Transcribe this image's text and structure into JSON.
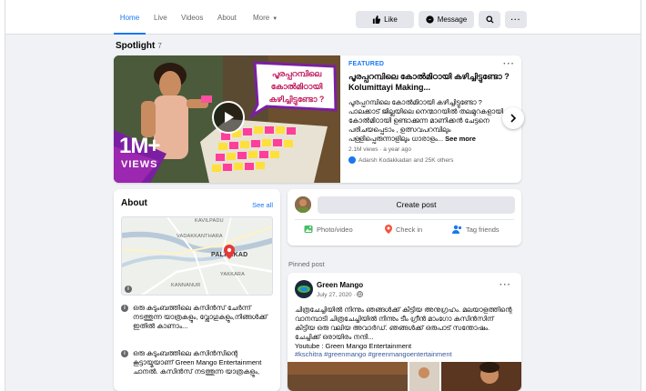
{
  "nav": {
    "tabs": [
      {
        "label": "Home",
        "active": true
      },
      {
        "label": "Live"
      },
      {
        "label": "Videos"
      },
      {
        "label": "About"
      },
      {
        "label": "More"
      }
    ],
    "like_label": "Like",
    "message_label": "Message"
  },
  "spotlight": {
    "title": "Spotlight",
    "count": "7",
    "thumbnail": {
      "overlay_text": "പൂരപ്പറമ്പിലെ കോൽമിഠായി കഴിച്ചിട്ടുണ്ടോ ?",
      "views_big": "1M+",
      "views_label": "VIEWS"
    },
    "featured_label": "FEATURED",
    "headline": "പൂരപ്പറമ്പിലെ കോൽമിഠായി കഴിച്ചിട്ടുണ്ടോ ? Kolumittayi Making...",
    "description": "പൂരപ്പറമ്പിലെ കോൽമിഠായി കഴിച്ചിട്ടുണ്ടോ ? പാലക്കാട് ജില്ലയിലെ നെന്മാറയിൽ തലമുറകളായി കോൽമിഠായി ഉണ്ടാക്കുന്ന മാണിക്കൻ ചേട്ടനെ പരിചയപ്പെടാം , ഉത്സവപറമ്പിലും പള്ളിപ്പെരുന്നാളിലും ധാരാളം...",
    "see_more": "See more",
    "meta": "2.1M views · a year ago",
    "reactions": "Adarsh Kodakkadan and 25K others"
  },
  "about": {
    "title": "About",
    "see_all": "See all",
    "map": {
      "place_main": "PALAKKAD",
      "labels": [
        "KAVILPADU",
        "VADAKKANTHARA",
        "YAKKARA",
        "KANNANUR"
      ]
    },
    "items": [
      "ഒരു കുടുംബത്തിലെ കസിൻസ് ചേർന്ന് നടത്തുന്ന യാത്രകളും, വ്ലോഗുകളും,നിങ്ങൾക്ക് ഇതിൽ കാണാം...",
      "ഒരു കുടുംബത്തിലെ കസിൻസിന്റെ കൂട്ടായ്മയാണ് Green Mango Entertainment ചാനൽ. കസിൻസ് നടത്തുന്ന യാത്രകളും,"
    ]
  },
  "create_post": {
    "button": "Create post",
    "actions": [
      "Photo/video",
      "Check in",
      "Tag friends"
    ]
  },
  "pinned": {
    "label": "Pinned post",
    "page_name": "Green Mango",
    "date": "July 27, 2020 ·",
    "text": "ചിത്രചേച്ചിയിൽ നിന്നും ഞങ്ങൾക്ക് കിട്ടിയ അനുഗ്രഹം. മലയാളത്തിന്റെ വാനമ്പാടി ചിത്രചേച്ചിയിൽ നിന്നും ടീം ഗ്രീൻ മാംഗോ കസിൻസിന് കിട്ടിയ ഒരു വലിയ അവാർഡ്. ഞങ്ങൾക്ക് ഒരുപാട് സന്തോഷം. ചേച്ചിക്ക് ഒരായിരം നന്ദി...",
    "youtube_line": "Youtube : Green Mango Entertainment",
    "tags": "#kschitra #greenmango #greenmangoentertainment"
  },
  "colors": {
    "accent": "#1877f2",
    "bg": "#f0f2f5",
    "thumb_purple": "#7b1fa2"
  }
}
